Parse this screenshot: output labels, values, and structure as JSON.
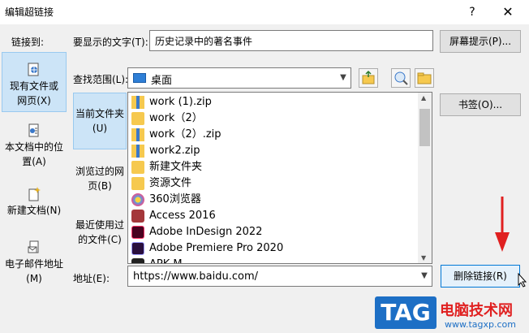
{
  "window": {
    "title": "编辑超链接",
    "help_label": "?",
    "close_label": "✕"
  },
  "link_to": {
    "header": "链接到:",
    "items": [
      {
        "label": "现有文件或网页(X)",
        "icon": "globe-file-icon",
        "selected": true
      },
      {
        "label": "本文档中的位置(A)",
        "icon": "document-place-icon",
        "selected": false
      },
      {
        "label": "新建文档(N)",
        "icon": "new-document-icon",
        "selected": false
      },
      {
        "label": "电子邮件地址(M)",
        "icon": "email-icon",
        "selected": false
      }
    ]
  },
  "display_text": {
    "label": "要显示的文字(T):",
    "value": "历史记录中的著名事件"
  },
  "screen_tip_button": "屏幕提示(P)...",
  "look_in": {
    "label": "查找范围(L):",
    "value": "桌面"
  },
  "bookmark_button": "书签(O)...",
  "shortcuts": [
    {
      "label": "当前文件夹(U)",
      "selected": true
    },
    {
      "label": "浏览过的网页(B)",
      "selected": false
    },
    {
      "label": "最近使用过的文件(C)",
      "selected": false
    }
  ],
  "files": [
    {
      "name": "work (1).zip",
      "icon": "zip-icon",
      "color": "#f6c94f"
    },
    {
      "name": "work（2）",
      "icon": "folder-icon",
      "color": "#f6c94f"
    },
    {
      "name": "work（2）.zip",
      "icon": "zip-icon",
      "color": "#f6c94f"
    },
    {
      "name": "work2.zip",
      "icon": "zip-icon",
      "color": "#f6c94f"
    },
    {
      "name": "新建文件夹",
      "icon": "folder-icon",
      "color": "#f6c94f"
    },
    {
      "name": "资源文件",
      "icon": "folder-icon",
      "color": "#f6c94f"
    },
    {
      "name": "360浏览器",
      "icon": "browser-360-icon",
      "color": "#4fa3e8"
    },
    {
      "name": "Access 2016",
      "icon": "access-icon",
      "color": "#a4373a"
    },
    {
      "name": "Adobe InDesign 2022",
      "icon": "indesign-icon",
      "color": "#49021f"
    },
    {
      "name": "Adobe Premiere Pro 2020",
      "icon": "premiere-icon",
      "color": "#2a0f3e"
    },
    {
      "name": "APK M...",
      "icon": "apk-icon",
      "color": "#222222"
    }
  ],
  "address": {
    "label": "地址(E):",
    "value": "https://www.baidu.com/"
  },
  "remove_link_button": "删除链接(R)",
  "watermark": {
    "tag": "TAG",
    "site": "电脑技术网",
    "url": "www.tagxp.com"
  },
  "colors": {
    "selection": "#cce4f7",
    "arrow": "#e02020",
    "watermark_blue": "#1d6fc5"
  }
}
